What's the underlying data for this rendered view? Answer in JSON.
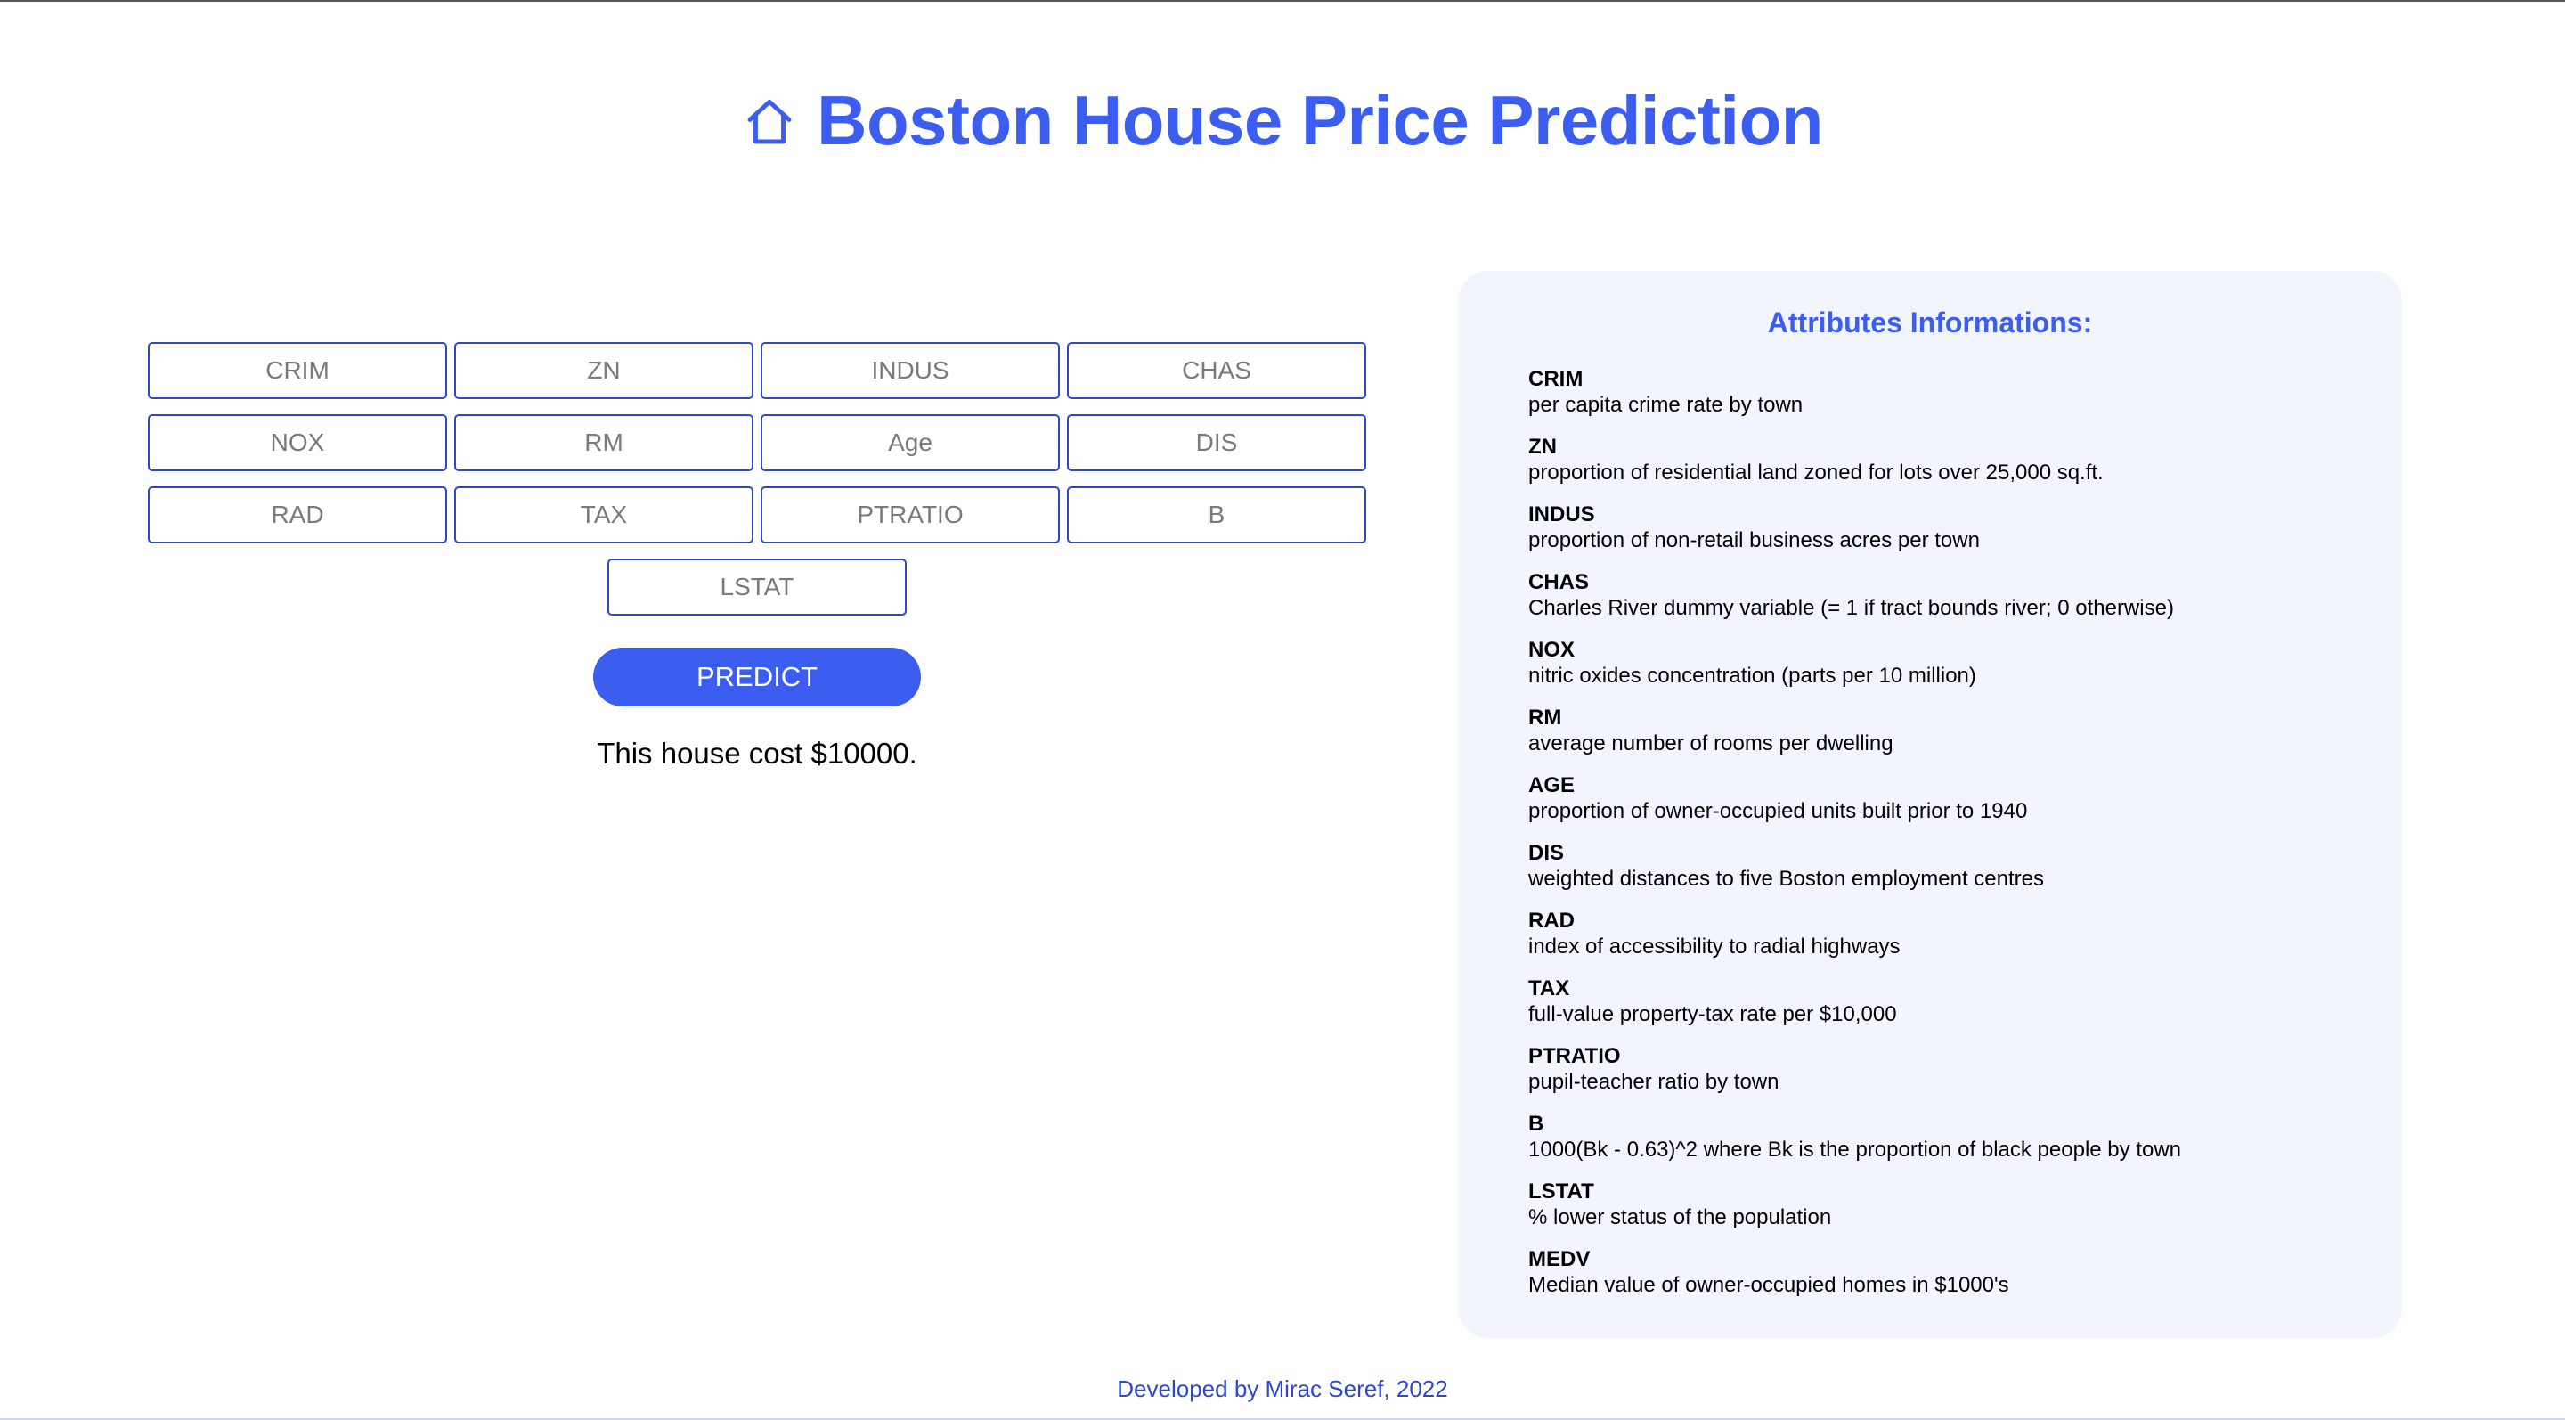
{
  "header": {
    "title": "Boston House Price Prediction",
    "icon": "home-icon",
    "accent_color": "#3b5ef0"
  },
  "form": {
    "inputs": [
      {
        "name": "crim",
        "placeholder": "CRIM",
        "value": ""
      },
      {
        "name": "zn",
        "placeholder": "ZN",
        "value": ""
      },
      {
        "name": "indus",
        "placeholder": "INDUS",
        "value": ""
      },
      {
        "name": "chas",
        "placeholder": "CHAS",
        "value": ""
      },
      {
        "name": "nox",
        "placeholder": "NOX",
        "value": ""
      },
      {
        "name": "rm",
        "placeholder": "RM",
        "value": ""
      },
      {
        "name": "age",
        "placeholder": "Age",
        "value": ""
      },
      {
        "name": "dis",
        "placeholder": "DIS",
        "value": ""
      },
      {
        "name": "rad",
        "placeholder": "RAD",
        "value": ""
      },
      {
        "name": "tax",
        "placeholder": "TAX",
        "value": ""
      },
      {
        "name": "ptratio",
        "placeholder": "PTRATIO",
        "value": ""
      },
      {
        "name": "b",
        "placeholder": "B",
        "value": ""
      },
      {
        "name": "lstat",
        "placeholder": "LSTAT",
        "value": ""
      }
    ],
    "predict_label": "PREDICT",
    "result_text": "This house cost $10000."
  },
  "info": {
    "title": "Attributes Informations:",
    "attributes": [
      {
        "name": "CRIM",
        "desc": "per capita crime rate by town"
      },
      {
        "name": "ZN",
        "desc": "proportion of residential land zoned for lots over 25,000 sq.ft."
      },
      {
        "name": "INDUS",
        "desc": "proportion of non-retail business acres per town"
      },
      {
        "name": "CHAS",
        "desc": "Charles River dummy variable (= 1 if tract bounds river; 0 otherwise)"
      },
      {
        "name": "NOX",
        "desc": "nitric oxides concentration (parts per 10 million)"
      },
      {
        "name": "RM",
        "desc": "average number of rooms per dwelling"
      },
      {
        "name": "AGE",
        "desc": "proportion of owner-occupied units built prior to 1940"
      },
      {
        "name": "DIS",
        "desc": "weighted distances to five Boston employment centres"
      },
      {
        "name": "RAD",
        "desc": "index of accessibility to radial highways"
      },
      {
        "name": "TAX",
        "desc": "full-value property-tax rate per $10,000"
      },
      {
        "name": "PTRATIO",
        "desc": "pupil-teacher ratio by town"
      },
      {
        "name": "B",
        "desc": "1000(Bk - 0.63)^2 where Bk is the proportion of black people by town"
      },
      {
        "name": "LSTAT",
        "desc": "% lower status of the population"
      },
      {
        "name": "MEDV",
        "desc": "Median value of owner-occupied homes in $1000's"
      }
    ]
  },
  "footer": {
    "text": "Developed by Mirac Seref, 2022"
  }
}
